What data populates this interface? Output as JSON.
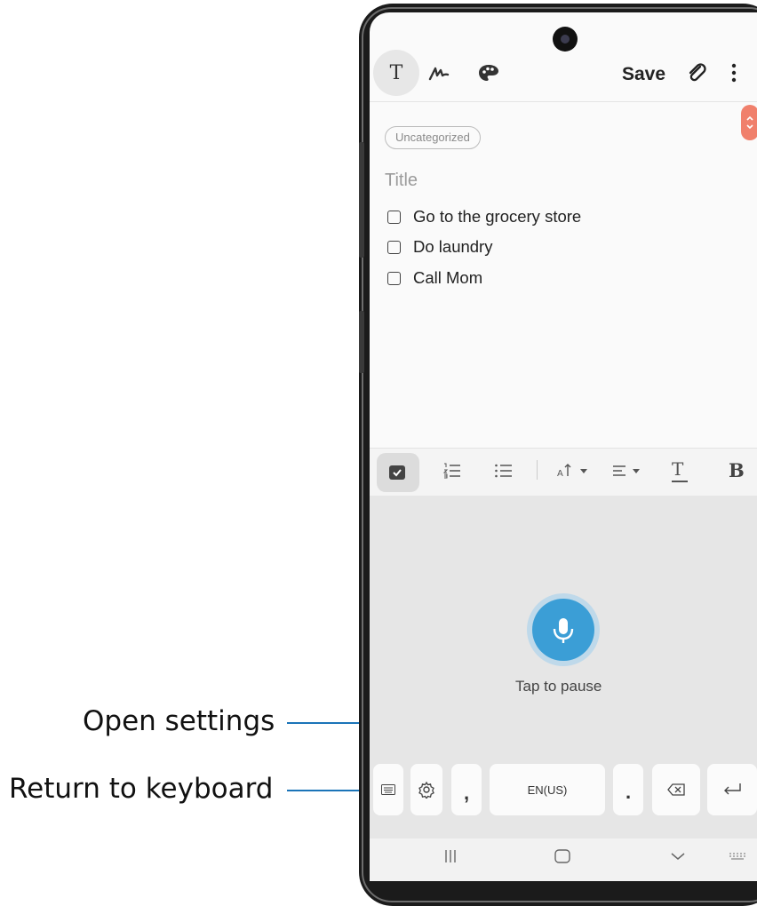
{
  "callouts": {
    "open_settings": "Open settings",
    "return_to_keyboard": "Return to keyboard"
  },
  "toolbar": {
    "text_mode": "T",
    "save_label": "Save"
  },
  "note": {
    "category_chip": "Uncategorized",
    "title_placeholder": "Title",
    "checklist": [
      "Go to the grocery store",
      "Do laundry",
      "Call Mom"
    ]
  },
  "format_bar": {
    "bold_label": "B",
    "text_label": "T"
  },
  "voice": {
    "status": "Tap to pause"
  },
  "keyboard": {
    "comma": ",",
    "language": "EN(US)",
    "period": "."
  },
  "colors": {
    "accent": "#1b74b8",
    "mic": "#3b9ed6",
    "scroll_handle": "#f0806c"
  },
  "icons": [
    "handwriting-icon",
    "palette-icon",
    "attach-icon",
    "more-icon",
    "checkbox-icon",
    "numbered-list-icon",
    "bullet-list-icon",
    "text-size-icon",
    "align-icon",
    "mic-icon",
    "keyboard-icon",
    "gear-icon",
    "backspace-icon",
    "enter-icon",
    "recents-icon",
    "home-icon",
    "back-icon",
    "keyboard-switch-icon"
  ]
}
